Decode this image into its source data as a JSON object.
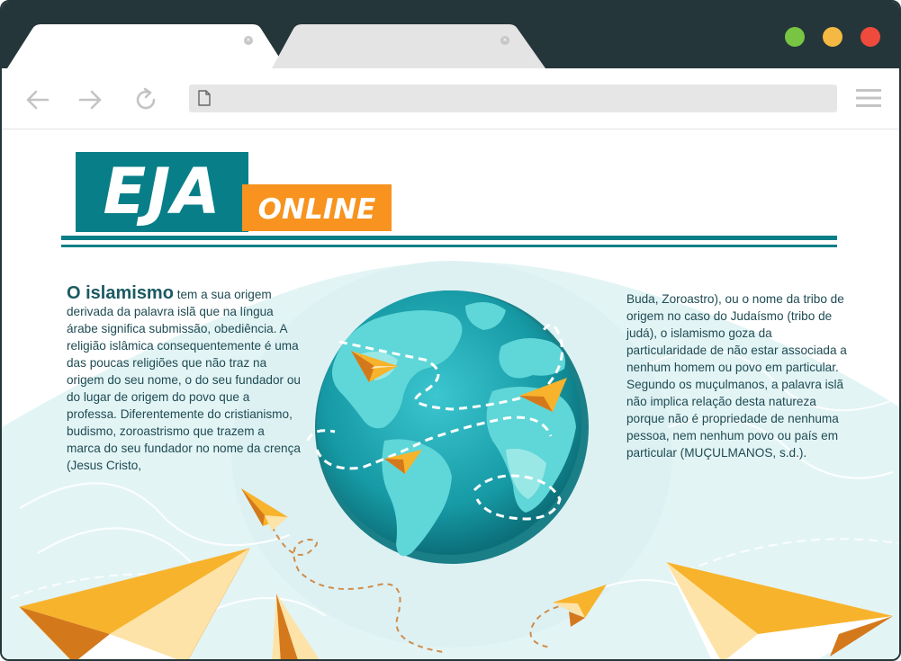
{
  "browser": {
    "tabs": [
      {
        "label": "",
        "active": true,
        "close_icon": "×"
      },
      {
        "label": "",
        "active": false,
        "close_icon": "×"
      }
    ],
    "window_controls": [
      {
        "name": "maximize",
        "color": "#77c543"
      },
      {
        "name": "minimize",
        "color": "#f4b942"
      },
      {
        "name": "close",
        "color": "#ee4b3c"
      }
    ],
    "address": {
      "value": ""
    },
    "icons": [
      "back-arrow-icon",
      "forward-arrow-icon",
      "reload-icon",
      "page-icon",
      "hamburger-menu-icon"
    ]
  },
  "logo": {
    "primary": "EJA",
    "secondary": "ONLINE",
    "colors": {
      "teal": "#087f88",
      "orange": "#f7931e"
    }
  },
  "article": {
    "heading": "O islamismo",
    "left_text": "tem a sua origem derivada da palavra islã que na língua árabe significa submissão, obediência. A religião islâmica consequentemente é uma das poucas religiões que não traz na origem do seu nome, o do seu fundador ou do lugar de origem do povo que a professa. Diferentemente do cristianismo, budismo, zoroastrismo que trazem a marca do seu fundador no nome da crença (Jesus Cristo,",
    "right_text": "Buda, Zoroastro), ou o nome da tribo de origem no caso do Judaísmo (tribo de judá), o islamismo goza da particularidade de não estar associada a nenhum homem ou povo em particular. Segundo os muçulmanos, a palavra islã não implica relação desta natureza porque não é propriedade de nenhuma pessoa, nem nenhum povo ou país em particular (MUÇULMANOS, s.d.)."
  },
  "illustration": {
    "subject": "globe-with-paper-planes",
    "icons": [
      "globe-icon",
      "paper-plane-icon"
    ]
  }
}
